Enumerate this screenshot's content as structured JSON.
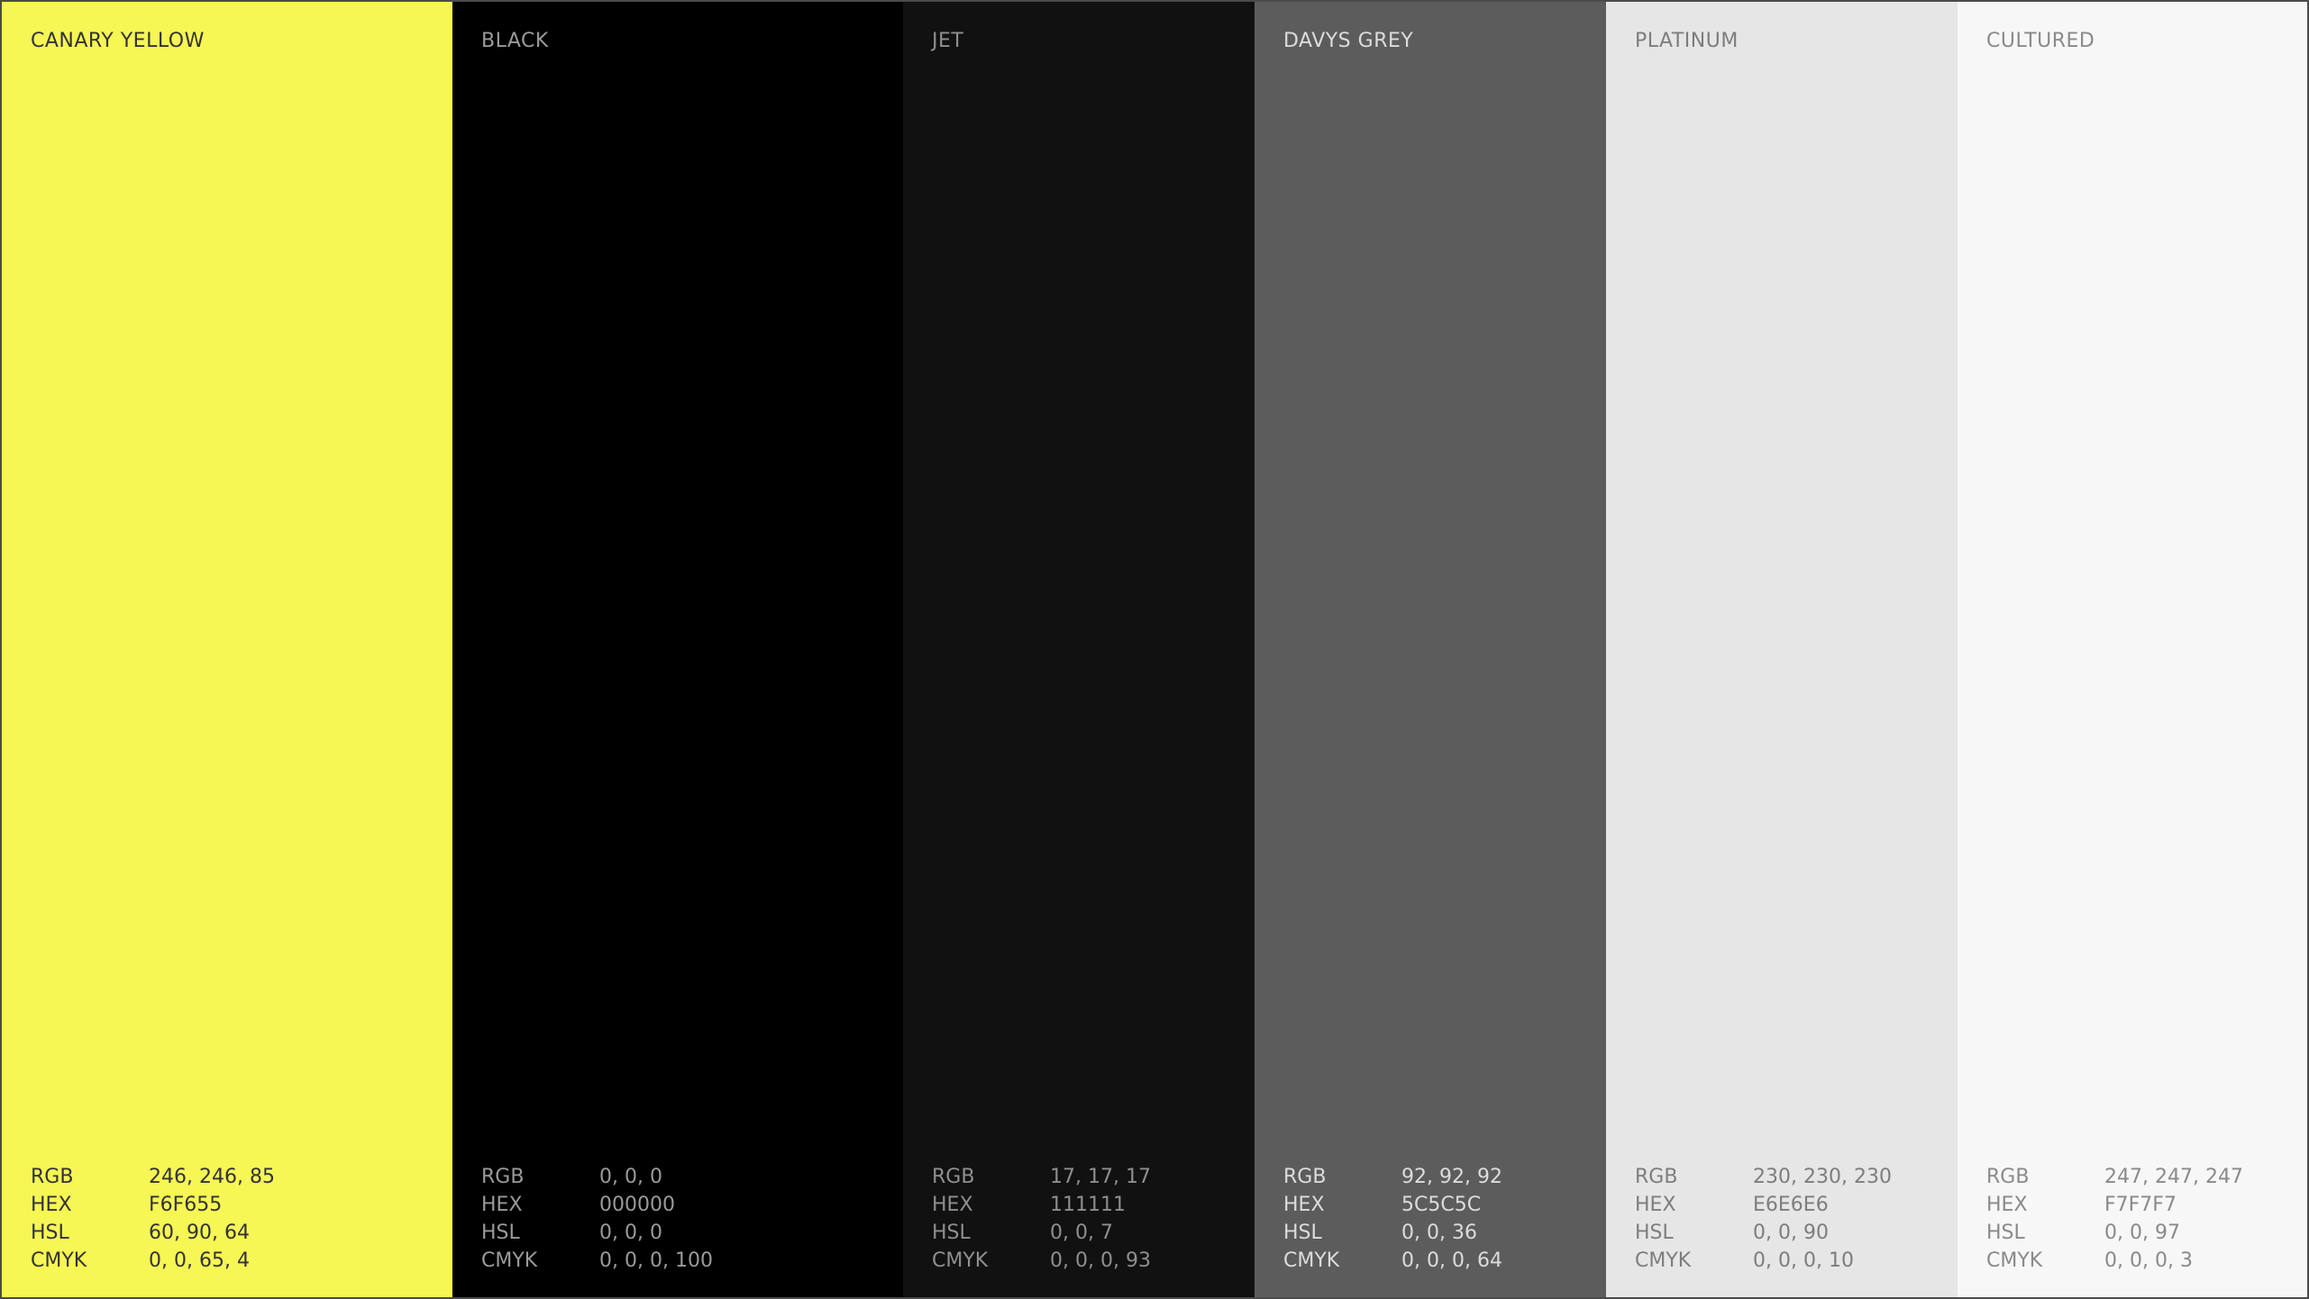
{
  "swatches": [
    {
      "name": "CANARY YELLOW",
      "color": "#F6F655",
      "text_color": "#333333",
      "values": [
        {
          "label": "RGB",
          "value": "246, 246, 85"
        },
        {
          "label": "HEX",
          "value": "F6F655"
        },
        {
          "label": "HSL",
          "value": "60, 90, 64"
        },
        {
          "label": "CMYK",
          "value": "0, 0, 65, 4"
        }
      ]
    },
    {
      "name": "BLACK",
      "color": "#000000",
      "text_color": "#9a9a9a",
      "values": [
        {
          "label": "RGB",
          "value": "0, 0, 0"
        },
        {
          "label": "HEX",
          "value": "000000"
        },
        {
          "label": "HSL",
          "value": "0, 0, 0"
        },
        {
          "label": "CMYK",
          "value": "0, 0, 0, 100"
        }
      ]
    },
    {
      "name": "JET",
      "color": "#111111",
      "text_color": "#8f8f8f",
      "values": [
        {
          "label": "RGB",
          "value": "17, 17, 17"
        },
        {
          "label": "HEX",
          "value": "111111"
        },
        {
          "label": "HSL",
          "value": "0, 0, 7"
        },
        {
          "label": "CMYK",
          "value": "0, 0, 0, 93"
        }
      ]
    },
    {
      "name": "DAVYS GREY",
      "color": "#5C5C5C",
      "text_color": "#dcdcdc",
      "values": [
        {
          "label": "RGB",
          "value": "92, 92, 92"
        },
        {
          "label": "HEX",
          "value": "5C5C5C"
        },
        {
          "label": "HSL",
          "value": "0, 0, 36"
        },
        {
          "label": "CMYK",
          "value": "0, 0, 0, 64"
        }
      ]
    },
    {
      "name": "PLATINUM",
      "color": "#E6E6E6",
      "text_color": "#7d7d7d",
      "values": [
        {
          "label": "RGB",
          "value": "230, 230, 230"
        },
        {
          "label": "HEX",
          "value": "E6E6E6"
        },
        {
          "label": "HSL",
          "value": "0, 0, 90"
        },
        {
          "label": "CMYK",
          "value": "0, 0, 0, 10"
        }
      ]
    },
    {
      "name": "CULTURED",
      "color": "#F7F7F7",
      "text_color": "#8a8a8a",
      "values": [
        {
          "label": "RGB",
          "value": "247, 247, 247"
        },
        {
          "label": "HEX",
          "value": "F7F7F7"
        },
        {
          "label": "HSL",
          "value": "0, 0, 97"
        },
        {
          "label": "CMYK",
          "value": "0, 0, 0, 3"
        }
      ]
    }
  ]
}
